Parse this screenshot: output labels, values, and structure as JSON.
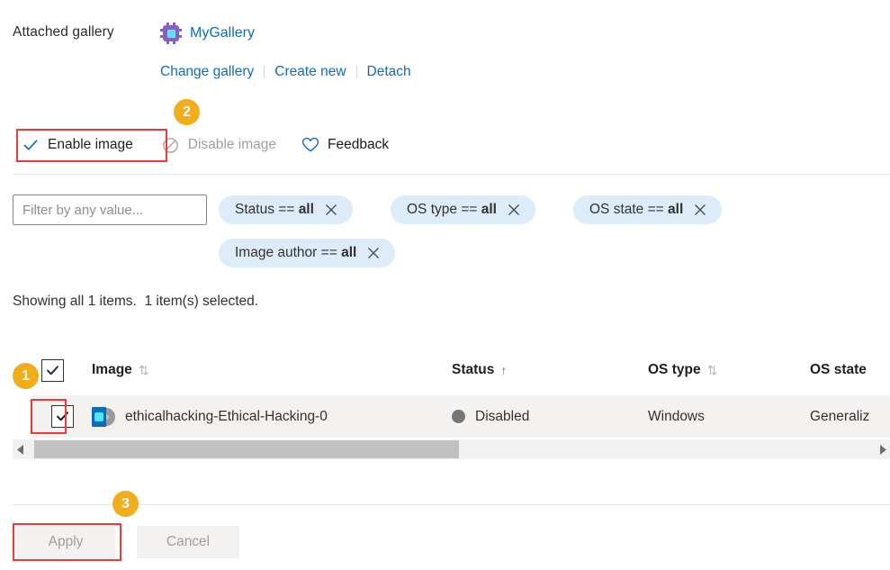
{
  "header": {
    "attached_gallery_label": "Attached gallery",
    "gallery_name": "MyGallery",
    "gallery_icon": "gallery-chip-icon",
    "actions": [
      {
        "label": "Change gallery"
      },
      {
        "label": "Create new"
      },
      {
        "label": "Detach"
      }
    ]
  },
  "command_bar": {
    "enable": {
      "label": "Enable image",
      "icon": "checkmark-icon",
      "enabled": true
    },
    "disable": {
      "label": "Disable image",
      "icon": "block-icon",
      "enabled": false
    },
    "feedback": {
      "label": "Feedback",
      "icon": "heart-icon",
      "enabled": true
    }
  },
  "annotations": {
    "badge_1": "1",
    "badge_2": "2",
    "badge_3": "3",
    "highlight_color": "#f03a3a",
    "badge_color": "#f2ad1a"
  },
  "filters": {
    "search_placeholder": "Filter by any value...",
    "search_value": "",
    "pills": [
      {
        "field": "Status",
        "operator": "==",
        "value": "all",
        "remove_icon": "close-icon"
      },
      {
        "field": "OS type",
        "operator": "==",
        "value": "all",
        "remove_icon": "close-icon"
      },
      {
        "field": "OS state",
        "operator": "==",
        "value": "all",
        "remove_icon": "close-icon"
      },
      {
        "field": "Image author",
        "operator": "==",
        "value": "all",
        "remove_icon": "close-icon"
      }
    ]
  },
  "results_summary": "Showing all 1 items.  1 item(s) selected.",
  "table": {
    "select_all_checked": true,
    "columns": [
      {
        "label": "Image",
        "sort_icon": "sort-both-icon"
      },
      {
        "label": "Status",
        "sort_icon": "sort-ascending-icon"
      },
      {
        "label": "OS type",
        "sort_icon": "sort-both-icon"
      },
      {
        "label": "OS state",
        "sort_icon": ""
      }
    ],
    "rows": [
      {
        "selected": true,
        "image_icon": "vm-image-icon",
        "image": "ethicalhacking-Ethical-Hacking-0",
        "status": "Disabled",
        "status_color": "#767676",
        "os_type": "Windows",
        "os_state": "Generaliz"
      }
    ]
  },
  "scrollbar": {
    "left_arrow": "chevron-left-icon",
    "right_arrow": "chevron-right-icon"
  },
  "footer": {
    "apply_label": "Apply",
    "cancel_label": "Cancel"
  }
}
